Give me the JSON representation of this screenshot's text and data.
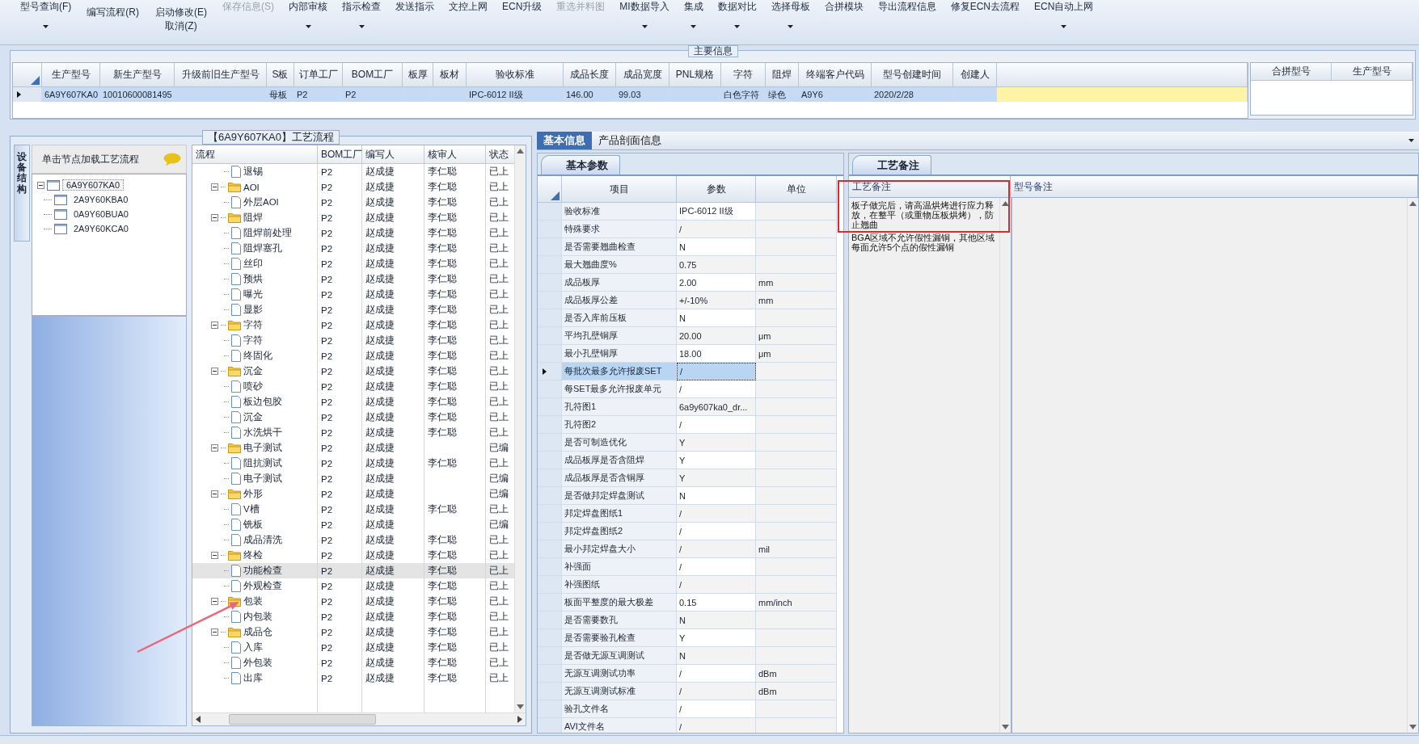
{
  "toolbar": [
    {
      "kind": "large",
      "label": "型号查询(F)",
      "dropdown": true,
      "disabled": false
    },
    {
      "kind": "stack",
      "buttons": [
        {
          "label": "编写流程(R)"
        }
      ]
    },
    {
      "kind": "stack",
      "buttons": [
        {
          "label": "启动修改(E)"
        },
        {
          "label": "取消(Z)"
        }
      ]
    },
    {
      "kind": "large",
      "label": "保存信息(S)",
      "dropdown": false,
      "disabled": true
    },
    {
      "kind": "large",
      "label": "内部审核",
      "dropdown": true,
      "disabled": false
    },
    {
      "kind": "large",
      "label": "指示检查",
      "dropdown": true,
      "disabled": false
    },
    {
      "kind": "large",
      "label": "发送指示",
      "dropdown": false,
      "disabled": false
    },
    {
      "kind": "large",
      "label": "文控上网",
      "dropdown": false,
      "disabled": false
    },
    {
      "kind": "large",
      "label": "ECN升级",
      "dropdown": false,
      "disabled": false
    },
    {
      "kind": "large",
      "label": "重选并料图",
      "dropdown": false,
      "disabled": true
    },
    {
      "kind": "large",
      "label": "MI数据导入",
      "dropdown": true,
      "disabled": false
    },
    {
      "kind": "large",
      "label": "集成",
      "dropdown": true,
      "disabled": false
    },
    {
      "kind": "large",
      "label": "数据对比",
      "dropdown": true,
      "disabled": false
    },
    {
      "kind": "large",
      "label": "选择母板",
      "dropdown": true,
      "disabled": false
    },
    {
      "kind": "large",
      "label": "合拼模块",
      "dropdown": false,
      "disabled": false
    },
    {
      "kind": "large",
      "label": "导出流程信息",
      "dropdown": false,
      "disabled": false
    },
    {
      "kind": "large",
      "label": "修复ECN去流程",
      "dropdown": false,
      "disabled": false
    },
    {
      "kind": "large",
      "label": "ECN自动上网",
      "dropdown": true,
      "disabled": false
    }
  ],
  "main_info": {
    "title": "主要信息",
    "columns": [
      "生产型号",
      "新生产型号",
      "升级前旧生产型号",
      "S板",
      "订单工厂",
      "BOM工厂",
      "板厚",
      "板材",
      "验收标准",
      "成品长度",
      "成品宽度",
      "PNL规格",
      "字符",
      "阻焊",
      "终端客户代码",
      "型号创建时间",
      "创建人"
    ],
    "rows": [
      {
        "selected": true,
        "cells": [
          "6A9Y607KA0",
          "10010600081495",
          null,
          "母板",
          "P2",
          "P2",
          null,
          null,
          "IPC-6012 II级",
          "146.00",
          "99.03",
          null,
          "白色字符",
          "绿色",
          "A9Y6",
          "2020/2/28",
          null
        ]
      }
    ],
    "merge_columns": [
      "合拼型号",
      "生产型号"
    ]
  },
  "flow": {
    "title": "【6A9Y607KA0】工艺流程",
    "side_tab": "设备结构",
    "tree_header": "单击节点加载工艺流程",
    "tree": [
      {
        "label": "6A9Y607KA0",
        "selected": true,
        "expanded": true,
        "children": [
          {
            "label": "2A9Y60KBA0",
            "selected": false
          },
          {
            "label": "0A9Y60BUA0",
            "selected": false
          },
          {
            "label": "2A9Y60KCA0",
            "selected": false
          }
        ]
      }
    ],
    "columns": [
      "流程",
      "BOM工厂",
      "编写人",
      "核审人",
      "状态"
    ],
    "rows": [
      {
        "kind": "doc",
        "name": "退锡",
        "bom": "P2",
        "writer": "赵成捷",
        "reviewer": "李仁聪",
        "status": "已上",
        "selected": false
      },
      {
        "kind": "folder",
        "name": "AOI",
        "bom": "P2",
        "writer": "赵成捷",
        "reviewer": "李仁聪",
        "status": "已上",
        "selected": false,
        "expanded": true,
        "children": [
          {
            "kind": "doc",
            "name": "外层AOI",
            "bom": "P2",
            "writer": "赵成捷",
            "reviewer": "李仁聪",
            "status": "已上",
            "selected": false
          }
        ]
      },
      {
        "kind": "folder",
        "name": "阻焊",
        "bom": "P2",
        "writer": "赵成捷",
        "reviewer": "李仁聪",
        "status": "已上",
        "selected": false,
        "expanded": true,
        "children": [
          {
            "kind": "doc",
            "name": "阻焊前处理",
            "bom": "P2",
            "writer": "赵成捷",
            "reviewer": "李仁聪",
            "status": "已上",
            "selected": false
          },
          {
            "kind": "doc",
            "name": "阻焊塞孔",
            "bom": "P2",
            "writer": "赵成捷",
            "reviewer": "李仁聪",
            "status": "已上",
            "selected": false
          },
          {
            "kind": "doc",
            "name": "丝印",
            "bom": "P2",
            "writer": "赵成捷",
            "reviewer": "李仁聪",
            "status": "已上",
            "selected": false
          },
          {
            "kind": "doc",
            "name": "预烘",
            "bom": "P2",
            "writer": "赵成捷",
            "reviewer": "李仁聪",
            "status": "已上",
            "selected": false
          },
          {
            "kind": "doc",
            "name": "曝光",
            "bom": "P2",
            "writer": "赵成捷",
            "reviewer": "李仁聪",
            "status": "已上",
            "selected": false
          },
          {
            "kind": "doc",
            "name": "显影",
            "bom": "P2",
            "writer": "赵成捷",
            "reviewer": "李仁聪",
            "status": "已上",
            "selected": false
          }
        ]
      },
      {
        "kind": "folder",
        "name": "字符",
        "bom": "P2",
        "writer": "赵成捷",
        "reviewer": "李仁聪",
        "status": "已上",
        "selected": false,
        "expanded": true,
        "children": [
          {
            "kind": "doc",
            "name": "字符",
            "bom": "P2",
            "writer": "赵成捷",
            "reviewer": "李仁聪",
            "status": "已上",
            "selected": false
          },
          {
            "kind": "doc",
            "name": "终固化",
            "bom": "P2",
            "writer": "赵成捷",
            "reviewer": "李仁聪",
            "status": "已上",
            "selected": false
          }
        ]
      },
      {
        "kind": "folder",
        "name": "沉金",
        "bom": "P2",
        "writer": "赵成捷",
        "reviewer": "李仁聪",
        "status": "已上",
        "selected": false,
        "expanded": true,
        "children": [
          {
            "kind": "doc",
            "name": "喷砂",
            "bom": "P2",
            "writer": "赵成捷",
            "reviewer": "李仁聪",
            "status": "已上",
            "selected": false
          },
          {
            "kind": "doc",
            "name": "板边包胶",
            "bom": "P2",
            "writer": "赵成捷",
            "reviewer": "李仁聪",
            "status": "已上",
            "selected": false
          },
          {
            "kind": "doc",
            "name": "沉金",
            "bom": "P2",
            "writer": "赵成捷",
            "reviewer": "李仁聪",
            "status": "已上",
            "selected": false
          },
          {
            "kind": "doc",
            "name": "水洗烘干",
            "bom": "P2",
            "writer": "赵成捷",
            "reviewer": "李仁聪",
            "status": "已上",
            "selected": false
          }
        ]
      },
      {
        "kind": "folder",
        "name": "电子测试",
        "bom": "P2",
        "writer": "赵成捷",
        "status": "已编",
        "selected": false,
        "expanded": true,
        "children": [
          {
            "kind": "doc",
            "name": "阻抗测试",
            "bom": "P2",
            "writer": "赵成捷",
            "reviewer": "李仁聪",
            "status": "已上",
            "selected": false
          },
          {
            "kind": "doc",
            "name": "电子测试",
            "bom": "P2",
            "writer": "赵成捷",
            "status": "已编",
            "selected": false
          }
        ]
      },
      {
        "kind": "folder",
        "name": "外形",
        "bom": "P2",
        "writer": "赵成捷",
        "status": "已编",
        "selected": false,
        "expanded": true,
        "children": [
          {
            "kind": "doc",
            "name": "V槽",
            "bom": "P2",
            "writer": "赵成捷",
            "reviewer": "李仁聪",
            "status": "已上",
            "selected": false
          },
          {
            "kind": "doc",
            "name": "铣板",
            "bom": "P2",
            "writer": "赵成捷",
            "status": "已编",
            "selected": false
          },
          {
            "kind": "doc",
            "name": "成品清洗",
            "bom": "P2",
            "writer": "赵成捷",
            "reviewer": "李仁聪",
            "status": "已上",
            "selected": false
          }
        ]
      },
      {
        "kind": "folder",
        "name": "终检",
        "bom": "P2",
        "writer": "赵成捷",
        "reviewer": "李仁聪",
        "status": "已上",
        "selected": false,
        "expanded": true,
        "children": [
          {
            "kind": "doc",
            "name": "功能检查",
            "bom": "P2",
            "writer": "赵成捷",
            "reviewer": "李仁聪",
            "status": "已上",
            "selected": true
          },
          {
            "kind": "doc",
            "name": "外观检查",
            "bom": "P2",
            "writer": "赵成捷",
            "reviewer": "李仁聪",
            "status": "已上",
            "selected": false
          }
        ]
      },
      {
        "kind": "folder",
        "name": "包装",
        "bom": "P2",
        "writer": "赵成捷",
        "reviewer": "李仁聪",
        "status": "已上",
        "selected": false,
        "expanded": true,
        "children": [
          {
            "kind": "doc",
            "name": "内包装",
            "bom": "P2",
            "writer": "赵成捷",
            "reviewer": "李仁聪",
            "status": "已上",
            "selected": false
          }
        ]
      },
      {
        "kind": "folder",
        "name": "成品仓",
        "bom": "P2",
        "writer": "赵成捷",
        "reviewer": "李仁聪",
        "status": "已上",
        "selected": false,
        "expanded": true,
        "children": [
          {
            "kind": "doc",
            "name": "入库",
            "bom": "P2",
            "writer": "赵成捷",
            "reviewer": "李仁聪",
            "status": "已上",
            "selected": false
          },
          {
            "kind": "doc",
            "name": "外包装",
            "bom": "P2",
            "writer": "赵成捷",
            "reviewer": "李仁聪",
            "status": "已上",
            "selected": false
          },
          {
            "kind": "doc",
            "name": "出库",
            "bom": "P2",
            "writer": "赵成捷",
            "reviewer": "李仁聪",
            "status": "已上",
            "selected": false
          }
        ]
      }
    ]
  },
  "detail": {
    "tabs": [
      {
        "label": "基本信息",
        "selected": true
      },
      {
        "label": "产品剖面信息",
        "selected": false
      }
    ],
    "params": {
      "tab": "基本参数",
      "columns": [
        "项目",
        "参数",
        "单位"
      ],
      "rows": [
        {
          "item": "验收标准",
          "value": "IPC-6012 II级",
          "selected": false
        },
        {
          "item": "特殊要求",
          "value": "/",
          "selected": false
        },
        {
          "item": "是否需要翘曲检查",
          "value": "N",
          "selected": false
        },
        {
          "item": "最大翘曲度%",
          "value": "0.75",
          "selected": false
        },
        {
          "item": "成品板厚",
          "value": "2.00",
          "unit": "mm",
          "selected": false
        },
        {
          "item": "成品板厚公差",
          "value": "+/-10%",
          "unit": "mm",
          "selected": false
        },
        {
          "item": "是否入库前压板",
          "value": "N",
          "selected": false
        },
        {
          "item": "平均孔壁铜厚",
          "value": "20.00",
          "unit": "μm",
          "selected": false
        },
        {
          "item": "最小孔壁铜厚",
          "value": "18.00",
          "unit": "μm",
          "selected": false
        },
        {
          "item": "每批次最多允许报废SET",
          "value": "/",
          "selected": true
        },
        {
          "item": "每SET最多允许报废单元",
          "value": "/",
          "selected": false
        },
        {
          "item": "孔符图1",
          "value": "6a9y607ka0_dr...",
          "selected": false
        },
        {
          "item": "孔符图2",
          "value": "/",
          "selected": false
        },
        {
          "item": "是否可制造优化",
          "value": "Y",
          "selected": false
        },
        {
          "item": "成品板厚是否含阻焊",
          "value": "Y",
          "selected": false
        },
        {
          "item": "成品板厚是否含铜厚",
          "value": "Y",
          "selected": false
        },
        {
          "item": "是否做邦定焊盘测试",
          "value": "N",
          "selected": false
        },
        {
          "item": "邦定焊盘图纸1",
          "value": "/",
          "selected": false
        },
        {
          "item": "邦定焊盘图纸2",
          "value": "/",
          "selected": false
        },
        {
          "item": "最小邦定焊盘大小",
          "value": "/",
          "unit": "mil",
          "selected": false
        },
        {
          "item": "补强面",
          "value": "/",
          "selected": false
        },
        {
          "item": "补强图纸",
          "value": "/",
          "selected": false
        },
        {
          "item": "板面平整度的最大极差",
          "value": "0.15",
          "unit": "mm/inch",
          "selected": false
        },
        {
          "item": "是否需要数孔",
          "value": "N",
          "selected": false
        },
        {
          "item": "是否需要验孔检查",
          "value": "Y",
          "selected": false
        },
        {
          "item": "是否做无源互调测试",
          "value": "N",
          "selected": false
        },
        {
          "item": "无源互调测试功率",
          "value": "/",
          "unit": "dBm",
          "selected": false
        },
        {
          "item": "无源互调测试标准",
          "value": "/",
          "unit": "dBm",
          "selected": false
        },
        {
          "item": "验孔文件名",
          "value": "/",
          "selected": false
        },
        {
          "item": "AVI文件名",
          "value": "/",
          "selected": false
        }
      ]
    },
    "notes": {
      "tab": "工艺备注",
      "columns": [
        "工艺备注",
        "型号备注"
      ],
      "process_notes": [
        "板子做完后，请高温烘烤进行应力释放，在整平（或重物压板烘烤），防止翘曲",
        "BGA区域不允许假性漏铜，其他区域每面允许5个点的假性漏铜"
      ]
    }
  },
  "markup": [
    {
      "kind": "box"
    },
    {
      "kind": "arrow"
    }
  ]
}
